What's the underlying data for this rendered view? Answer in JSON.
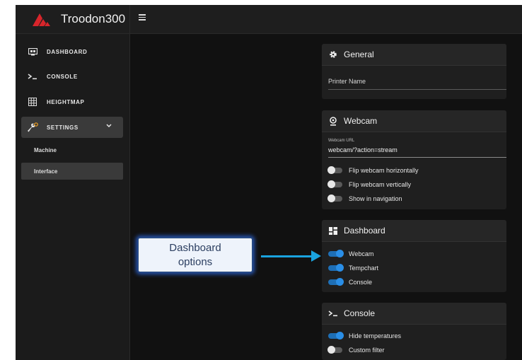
{
  "brand": {
    "title": "Troodon300"
  },
  "sidebar": {
    "items": [
      {
        "label": "DASHBOARD",
        "icon": "monitor-icon"
      },
      {
        "label": "CONSOLE",
        "icon": "terminal-icon"
      },
      {
        "label": "HEIGHTMAP",
        "icon": "grid-icon"
      },
      {
        "label": "SETTINGS",
        "icon": "wrench-gear-icon"
      }
    ],
    "settings_sub": [
      {
        "label": "Machine"
      },
      {
        "label": "Interface"
      }
    ]
  },
  "cards": {
    "general": {
      "title": "General",
      "printer_name_label": "Printer Name"
    },
    "webcam": {
      "title": "Webcam",
      "url_label": "Webcam URL",
      "url_value": "webcam/?action=stream",
      "toggles": [
        {
          "label": "Flip webcam horizontally",
          "on": false
        },
        {
          "label": "Flip webcam vertically",
          "on": false
        },
        {
          "label": "Show in navigation",
          "on": false
        }
      ]
    },
    "dashboard": {
      "title": "Dashboard",
      "toggles": [
        {
          "label": "Webcam",
          "on": true
        },
        {
          "label": "Tempchart",
          "on": true
        },
        {
          "label": "Console",
          "on": true
        }
      ]
    },
    "console": {
      "title": "Console",
      "toggles": [
        {
          "label": "Hide temperatures",
          "on": true
        },
        {
          "label": "Custom filter",
          "on": false
        }
      ]
    }
  },
  "callout": {
    "line1": "Dashboard",
    "line2": "options"
  },
  "colors": {
    "accent": "#2a8ee6",
    "arrow": "#1aa3df",
    "logo": "#d8252b"
  }
}
